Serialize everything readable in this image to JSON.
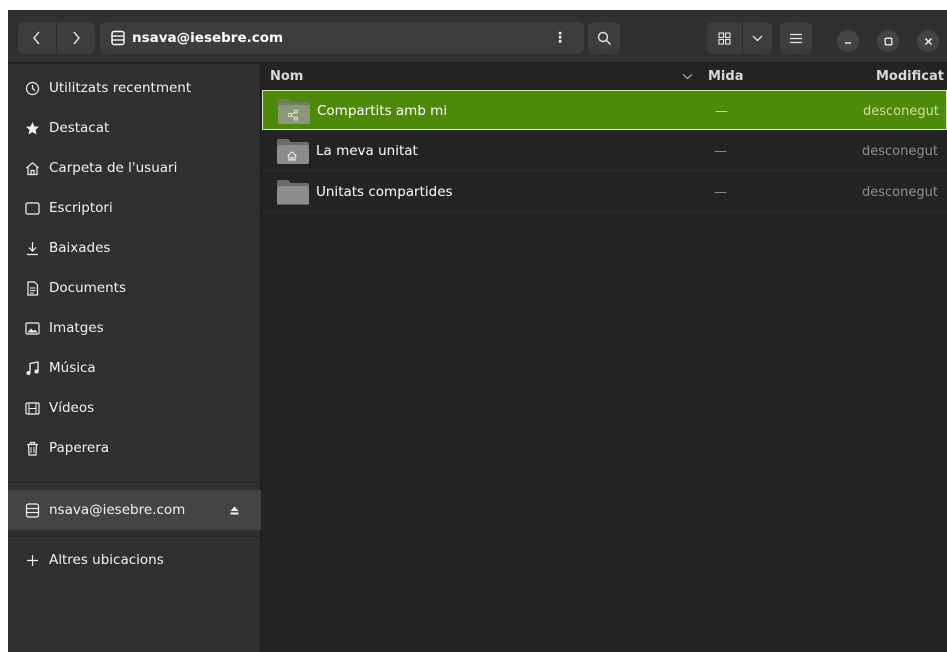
{
  "header": {
    "back_icon": "chevron-left-icon",
    "forward_icon": "chevron-right-icon",
    "location_icon": "network-server-icon",
    "location": "nsava@iesebre.com",
    "path_menu": "⋮",
    "search_icon": "search-icon",
    "view_icon": "grid-view-icon",
    "view_dropdown_icon": "chevron-down-icon",
    "main_menu_icon": "hamburger-menu-icon",
    "minimize_icon": "minimize-icon",
    "maximize_icon": "maximize-icon",
    "close_icon": "close-icon"
  },
  "sidebar": {
    "items": [
      {
        "label": "Utilitzats recentment",
        "icon": "clock-icon"
      },
      {
        "label": "Destacat",
        "icon": "star-icon"
      },
      {
        "label": "Carpeta de l'usuari",
        "icon": "home-icon"
      },
      {
        "label": "Escriptori",
        "icon": "desktop-icon"
      },
      {
        "label": "Baixades",
        "icon": "download-icon"
      },
      {
        "label": "Documents",
        "icon": "document-icon"
      },
      {
        "label": "Imatges",
        "icon": "image-icon"
      },
      {
        "label": "Música",
        "icon": "music-icon"
      },
      {
        "label": "Vídeos",
        "icon": "video-icon"
      },
      {
        "label": "Paperera",
        "icon": "trash-icon"
      }
    ],
    "account": {
      "label": "nsava@iesebre.com",
      "icon": "network-server-icon",
      "eject_icon": "eject-icon"
    },
    "other_locations": {
      "label": "Altres ubicacions",
      "icon": "plus-icon"
    }
  },
  "list": {
    "columns": {
      "name": "Nom",
      "size": "Mida",
      "modified": "Modificat"
    },
    "rows": [
      {
        "name": "Compartits amb mi",
        "size": "—",
        "modified": "desconegut",
        "icon": "shared-folder-icon",
        "selected": true
      },
      {
        "name": "La meva unitat",
        "size": "—",
        "modified": "desconegut",
        "icon": "home-folder-icon",
        "selected": false
      },
      {
        "name": "Unitats compartides",
        "size": "—",
        "modified": "desconegut",
        "icon": "shared-drive-folder-icon",
        "selected": false
      }
    ]
  },
  "colors": {
    "accent": "#4e8a0a",
    "window_bg": "#242424",
    "sidebar_bg": "#303030",
    "folder": "#7a8a6a"
  }
}
